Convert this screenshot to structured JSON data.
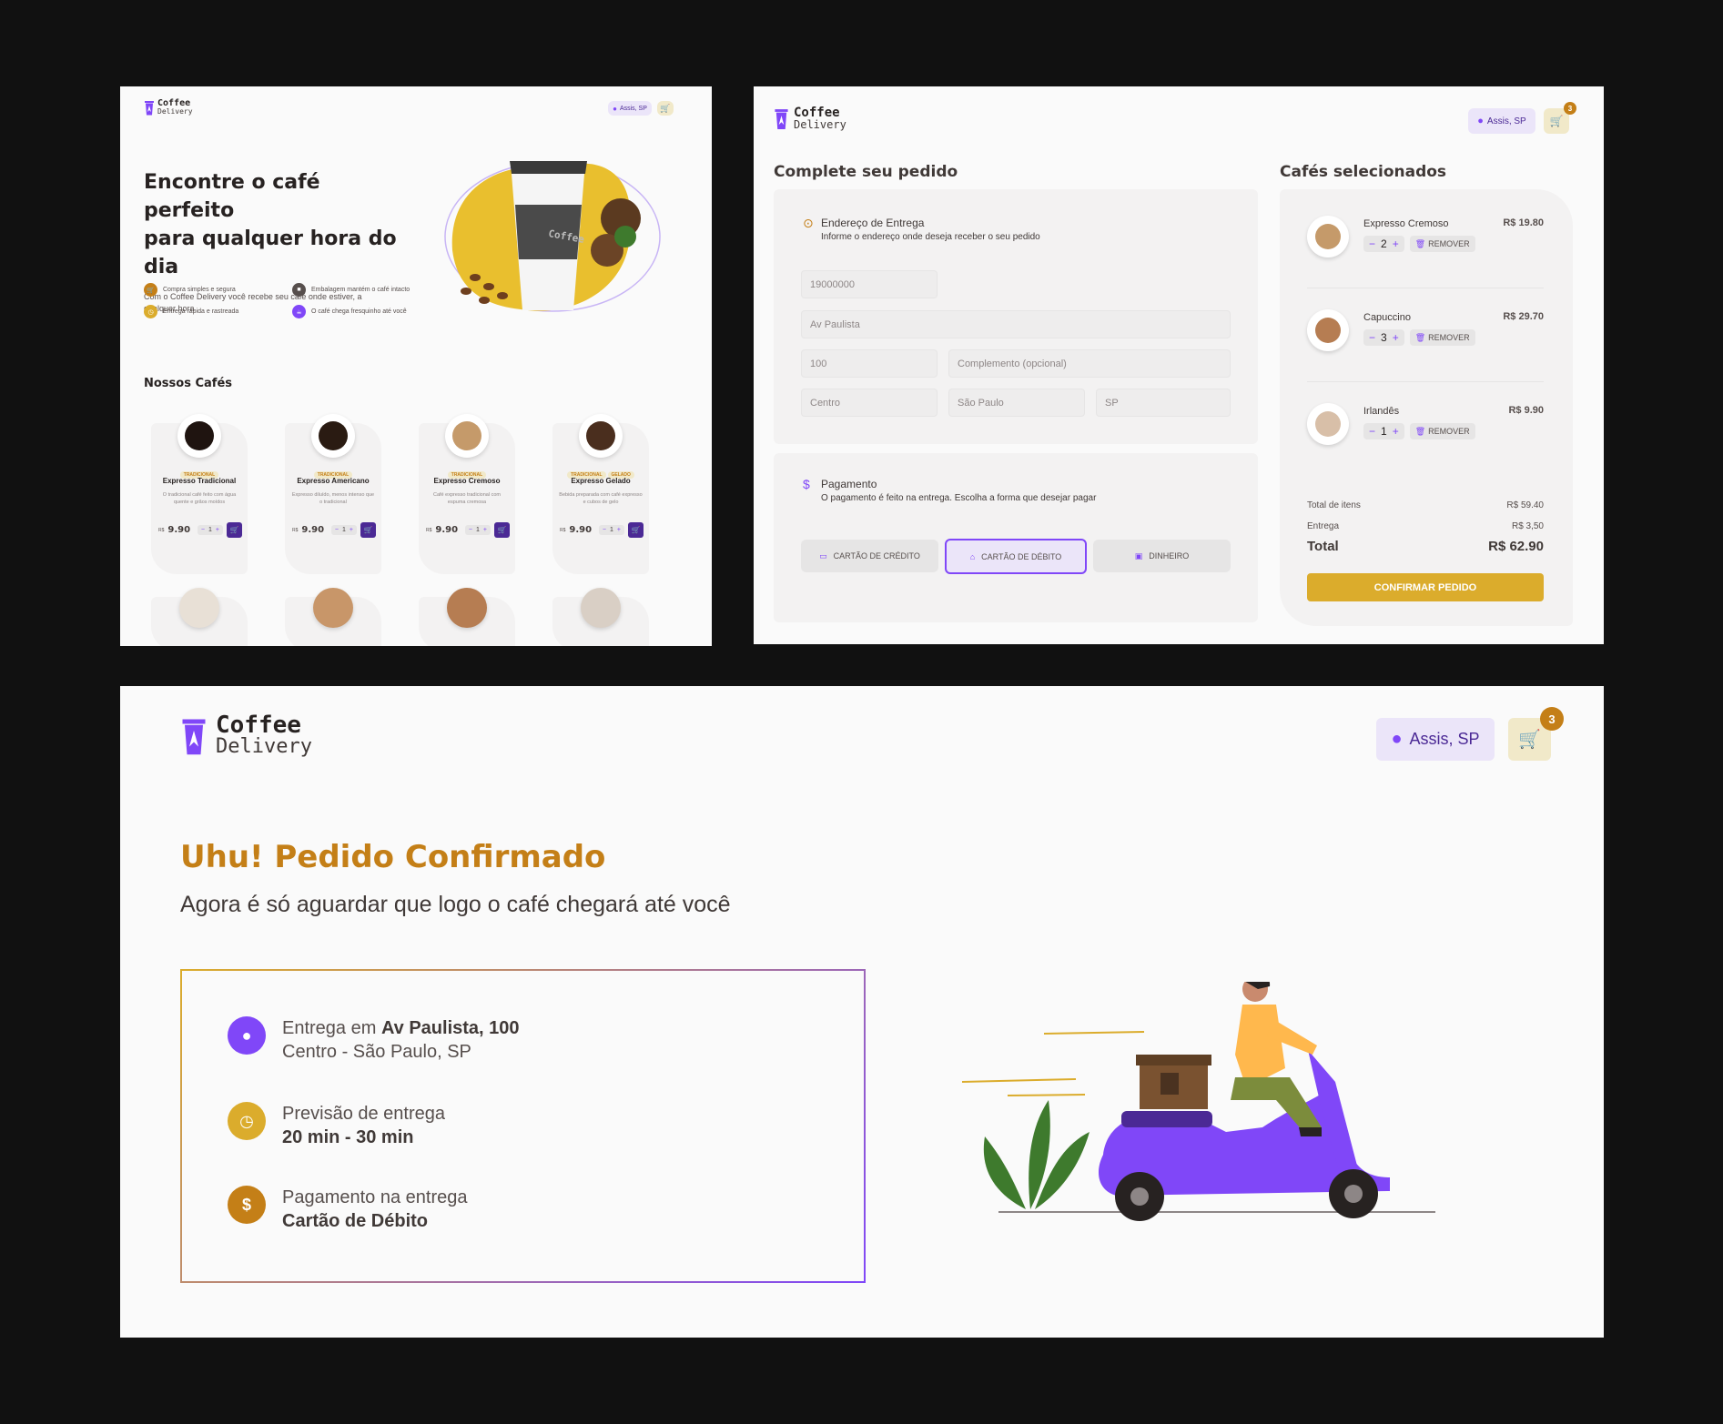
{
  "brand": {
    "line1": "Coffee",
    "line2": "Delivery"
  },
  "header": {
    "location": "Assis, SP",
    "cart_count": "3"
  },
  "home": {
    "hero_title_line1": "Encontre o café perfeito",
    "hero_title_line2": "para qualquer hora do dia",
    "hero_subtitle": "Com o Coffee Delivery você recebe seu café onde estiver, a qualquer hora",
    "features": [
      {
        "text": "Compra simples e segura",
        "icon": "cart-icon",
        "color": "#C47F17"
      },
      {
        "text": "Embalagem mantém o café intacto",
        "icon": "package-icon",
        "color": "#574F4D"
      },
      {
        "text": "Entrega rápida e rastreada",
        "icon": "timer-icon",
        "color": "#DBAC2C"
      },
      {
        "text": "O café chega fresquinho até você",
        "icon": "coffee-icon",
        "color": "#8047F8"
      }
    ],
    "section_title": "Nossos Cafés",
    "products": [
      {
        "name": "Expresso Tradicional",
        "tags": [
          "TRADICIONAL"
        ],
        "desc": "O tradicional café feito com água quente e grãos moídos",
        "currency": "R$",
        "price": "9.90",
        "qty": "1"
      },
      {
        "name": "Expresso Americano",
        "tags": [
          "TRADICIONAL"
        ],
        "desc": "Expresso diluído, menos intenso que o tradicional",
        "currency": "R$",
        "price": "9.90",
        "qty": "1"
      },
      {
        "name": "Expresso Cremoso",
        "tags": [
          "TRADICIONAL"
        ],
        "desc": "Café expresso tradicional com espuma cremosa",
        "currency": "R$",
        "price": "9.90",
        "qty": "1"
      },
      {
        "name": "Expresso Gelado",
        "tags": [
          "TRADICIONAL",
          "GELADO"
        ],
        "desc": "Bebida preparada com café expresso e cubos de gelo",
        "currency": "R$",
        "price": "9.90",
        "qty": "1"
      }
    ]
  },
  "checkout": {
    "title": "Complete seu pedido",
    "address": {
      "heading": "Endereço de Entrega",
      "sub": "Informe o endereço onde deseja receber o seu pedido",
      "cep": "19000000",
      "street": "Av Paulista",
      "number": "100",
      "complement_placeholder": "Complemento (opcional)",
      "district": "Centro",
      "city": "São Paulo",
      "uf": "SP"
    },
    "payment": {
      "heading": "Pagamento",
      "sub": "O pagamento é feito na entrega. Escolha a forma que desejar pagar",
      "options": [
        "CARTÃO DE CRÉDITO",
        "CARTÃO DE DÉBITO",
        "DINHEIRO"
      ],
      "selected": "CARTÃO DE DÉBITO"
    },
    "selected_title": "Cafés selecionados",
    "items": [
      {
        "name": "Expresso Cremoso",
        "qty": "2",
        "price": "R$ 19.80",
        "remove": "REMOVER"
      },
      {
        "name": "Capuccino",
        "qty": "3",
        "price": "R$ 29.70",
        "remove": "REMOVER"
      },
      {
        "name": "Irlandês",
        "qty": "1",
        "price": "R$ 9.90",
        "remove": "REMOVER"
      }
    ],
    "totals": {
      "items_label": "Total de itens",
      "items_value": "R$ 59.40",
      "delivery_label": "Entrega",
      "delivery_value": "R$ 3,50",
      "total_label": "Total",
      "total_value": "R$ 62.90"
    },
    "confirm": "CONFIRMAR PEDIDO"
  },
  "success": {
    "title": "Uhu! Pedido Confirmado",
    "subtitle": "Agora é só aguardar que logo o café chegará até você",
    "delivery_prefix": "Entrega em ",
    "delivery_address": "Av Paulista, 100",
    "delivery_line2": "Centro - São Paulo, SP",
    "eta_label": "Previsão de entrega",
    "eta_value": "20 min - 30 min",
    "pay_label": "Pagamento na entrega",
    "pay_value": "Cartão de Débito"
  },
  "colors": {
    "purple": "#8047F8",
    "purple_dark": "#4B2995",
    "yellow": "#DBAC2C",
    "yellow_dark": "#C47F17",
    "background": "#FAFAFA",
    "page_bg": "#111111"
  }
}
